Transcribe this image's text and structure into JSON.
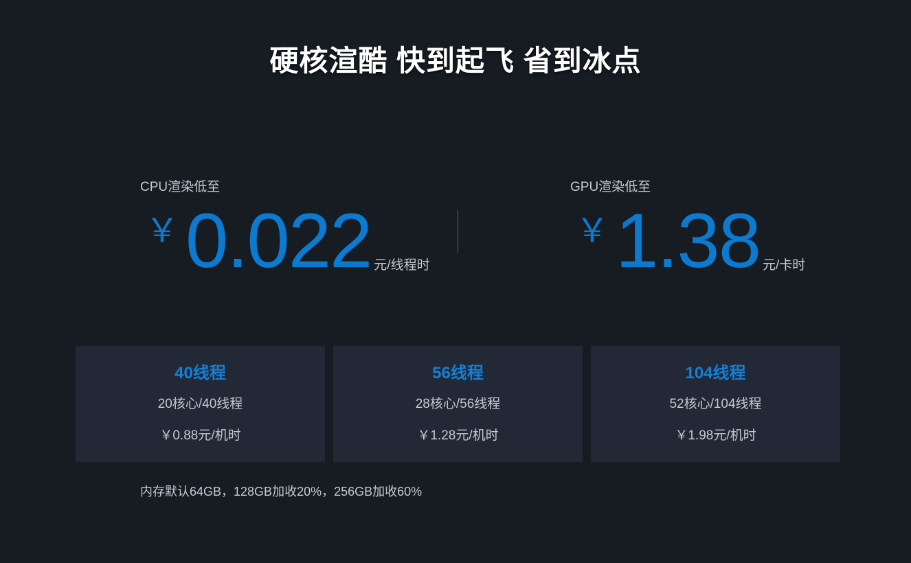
{
  "hero": {
    "title": "硬核渲酷 快到起飞 省到冰点"
  },
  "cpu": {
    "label": "CPU渲染低至",
    "currency": "￥",
    "price": "0.022",
    "unit": "元/线程时"
  },
  "gpu": {
    "label": "GPU渲染低至",
    "currency": "￥",
    "price": "1.38",
    "unit": "元/卡时"
  },
  "plans": [
    {
      "title": "40线程",
      "spec": "20核心/40线程",
      "price": "￥0.88元/机时"
    },
    {
      "title": "56线程",
      "spec": "28核心/56线程",
      "price": "￥1.28元/机时"
    },
    {
      "title": "104线程",
      "spec": "52核心/104线程",
      "price": "￥1.98元/机时"
    }
  ],
  "footnote": "内存默认64GB，128GB加收20%，256GB加收60%",
  "colors": {
    "background": "#171c23",
    "card": "#222835",
    "accent": "#0b7ad1",
    "text_muted": "#c4c8cf",
    "title": "#ffffff"
  }
}
